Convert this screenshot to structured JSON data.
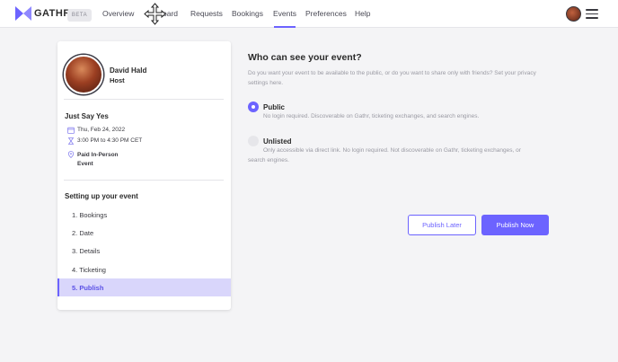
{
  "brand": {
    "name": "GATHR",
    "beta": "BETA",
    "accent": "#6c63ff"
  },
  "nav": {
    "items": [
      {
        "label": "Overview"
      },
      {
        "label": "oard"
      },
      {
        "label": "Requests"
      },
      {
        "label": "Bookings"
      },
      {
        "label": "Events"
      },
      {
        "label": "Preferences"
      },
      {
        "label": "Help"
      }
    ],
    "active": "Events"
  },
  "sidebar": {
    "host": {
      "name": "David Hald",
      "role": "Host"
    },
    "event": {
      "title": "Just Say Yes",
      "date": "Thu, Feb 24, 2022",
      "time": "3:00 PM to 4:30 PM CET",
      "type_line1": "Paid In-Person",
      "type_line2": "Event"
    },
    "setup_title": "Setting up your event",
    "steps": [
      {
        "label": "1. Bookings"
      },
      {
        "label": "2. Date"
      },
      {
        "label": "3. Details"
      },
      {
        "label": "4. Ticketing"
      },
      {
        "label": "5. Publish"
      }
    ],
    "active_step": "5. Publish"
  },
  "main": {
    "title": "Who can see your event?",
    "description": "Do you want your event to be available to the public, or do you want to share only with friends? Set your privacy settings here.",
    "options": [
      {
        "label": "Public",
        "desc": "No login required. Discoverable on Gathr, ticketing exchanges, and search engines.",
        "selected": true
      },
      {
        "label": "Unlisted",
        "desc": "Only accessible via direct link. No login required. Not discoverable on Gathr, ticketing exchanges, or search engines.",
        "selected": false
      }
    ],
    "buttons": {
      "later": "Publish Later",
      "now": "Publish Now"
    }
  }
}
